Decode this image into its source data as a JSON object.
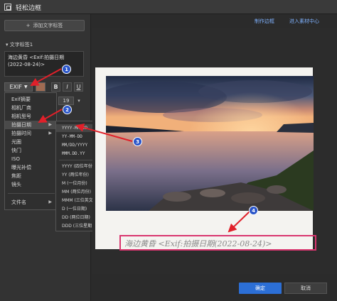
{
  "window": {
    "title": "轻松边框"
  },
  "left": {
    "add_button": "添加文字标签",
    "section_label": "文字标签1",
    "text_line1": "海边黄昏  <Exif:拍摄日期",
    "text_line2": "(2022-08-24)>",
    "exif_label": "EXIF",
    "bold": "B",
    "italic": "I",
    "underline": "U",
    "font_size": "19"
  },
  "menu1": {
    "items": [
      "Exif摘要",
      "相机厂商",
      "相机型号",
      "拍摄日期",
      "拍摄时间",
      "光圈",
      "快门",
      "ISO",
      "曝光补偿",
      "焦距",
      "镜头",
      "文件名"
    ]
  },
  "menu2": {
    "items": [
      "YYYY-MM-DD",
      "YY-MM-DD",
      "MM/DD/YYYY",
      "MMM.DD.YY",
      "YYYY (四位年份)",
      "YY (两位年份)",
      "M (一位月份)",
      "MM (两位月份)",
      "MMM (三位英文月份)",
      "D (一位日期)",
      "DD (两位日期)",
      "DDD (三位星期日期)"
    ]
  },
  "toplinks": {
    "make_frame": "制作边框",
    "material_center": "进入素材中心"
  },
  "preview": {
    "caption": "海边黄昏  <Exif:拍摄日期(2022-08-24)>"
  },
  "buttons": {
    "ok": "确定",
    "cancel": "取消"
  },
  "markers": [
    "1",
    "2",
    "3",
    "4"
  ],
  "colors": {
    "accent": "#2c6fd6",
    "callout": "#2a55c9",
    "arrow": "#e0202a",
    "highlight": "#d9356f"
  }
}
